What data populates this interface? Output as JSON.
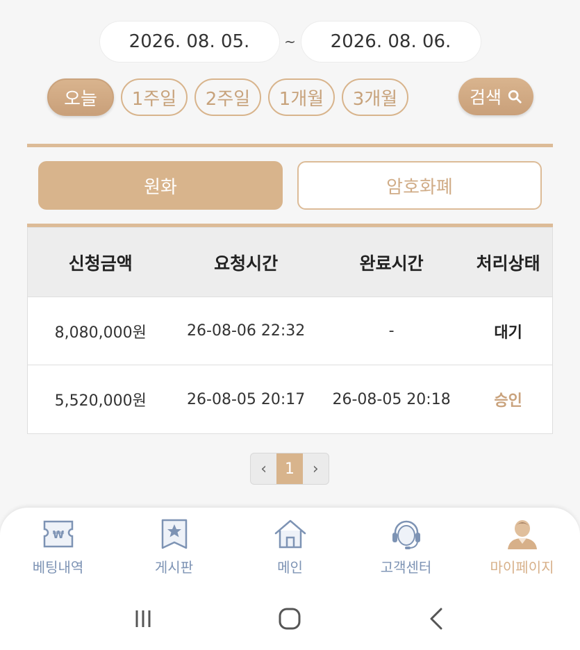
{
  "date_range": {
    "start": "2026. 08. 05.",
    "separator": "~",
    "end": "2026. 08. 06."
  },
  "periods": [
    {
      "label": "오늘",
      "active": true
    },
    {
      "label": "1주일",
      "active": false
    },
    {
      "label": "2주일",
      "active": false
    },
    {
      "label": "1개월",
      "active": false
    },
    {
      "label": "3개월",
      "active": false
    }
  ],
  "search_label": "검색",
  "currency_tabs": [
    {
      "label": "원화",
      "active": true
    },
    {
      "label": "암호화폐",
      "active": false
    }
  ],
  "table": {
    "headers": [
      "신청금액",
      "요청시간",
      "완료시간",
      "처리상태"
    ],
    "rows": [
      {
        "amount": "8,080,000원",
        "requested": "26-08-06 22:32",
        "completed": "-",
        "status": "대기"
      },
      {
        "amount": "5,520,000원",
        "requested": "26-08-05 20:17",
        "completed": "26-08-05 20:18",
        "status": "승인"
      }
    ]
  },
  "pagination": {
    "prev": "‹",
    "current": "1",
    "next": "›"
  },
  "bottom_nav": [
    {
      "label": "베팅내역",
      "icon": "betting-ticket-icon"
    },
    {
      "label": "게시판",
      "icon": "board-star-icon"
    },
    {
      "label": "메인",
      "icon": "home-icon"
    },
    {
      "label": "고객센터",
      "icon": "headset-icon"
    },
    {
      "label": "마이페이지",
      "icon": "user-icon",
      "active": true
    }
  ],
  "colors": {
    "accent": "#d8b48c",
    "nav_icon": "#7d93b4",
    "nav_active": "#d7b089"
  }
}
